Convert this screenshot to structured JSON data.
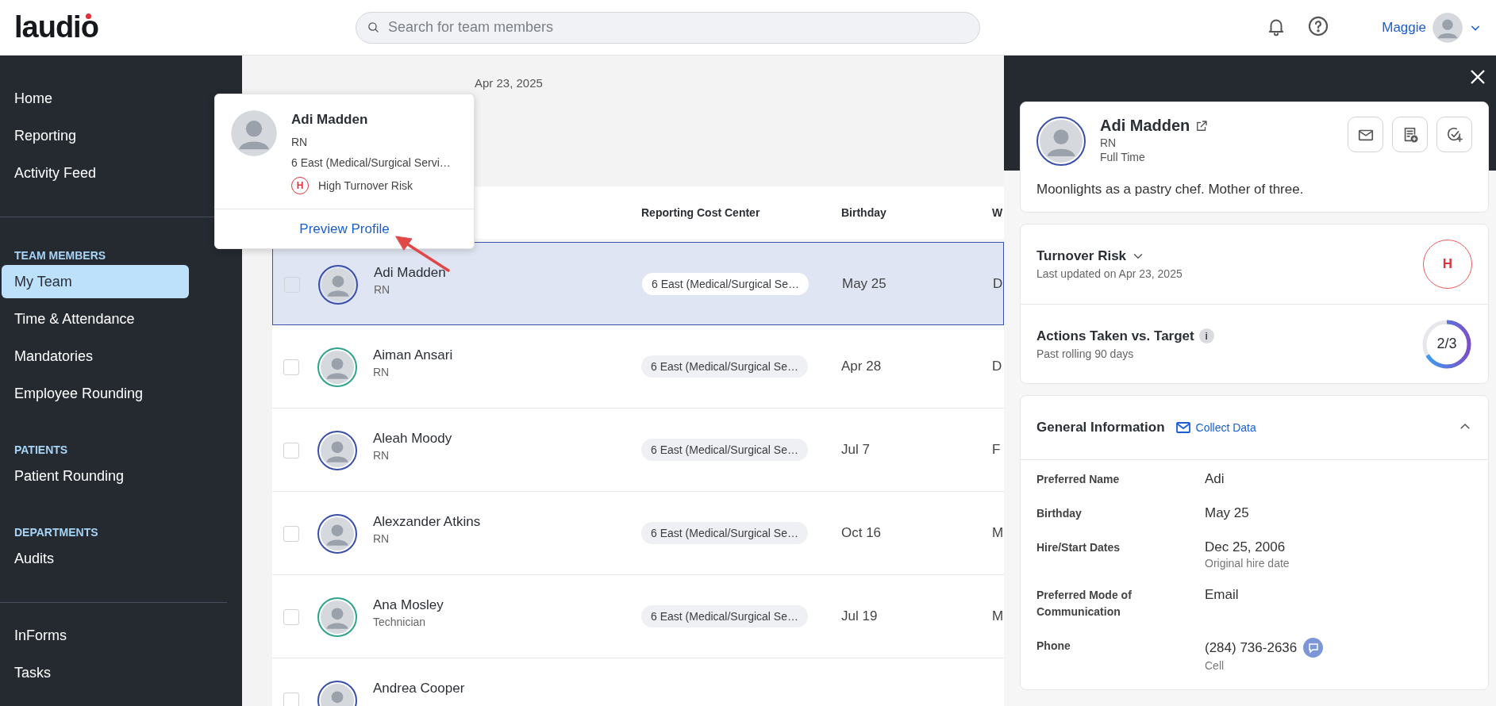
{
  "header": {
    "logo": "laudio",
    "search": {
      "placeholder": "Search for team members"
    },
    "user": {
      "name": "Maggie"
    }
  },
  "sidebar": {
    "groups": [
      {
        "items": [
          {
            "label": "Home",
            "selected": false
          },
          {
            "label": "Reporting",
            "selected": false
          },
          {
            "label": "Activity Feed",
            "selected": false
          }
        ]
      },
      {
        "heading": "TEAM MEMBERS",
        "items": [
          {
            "label": "My Team",
            "selected": true
          },
          {
            "label": "Time & Attendance",
            "selected": false
          },
          {
            "label": "Mandatories",
            "selected": false
          },
          {
            "label": "Employee Rounding",
            "selected": false
          }
        ]
      },
      {
        "heading": "PATIENTS",
        "items": [
          {
            "label": "Patient Rounding",
            "selected": false
          }
        ]
      },
      {
        "heading": "DEPARTMENTS",
        "items": [
          {
            "label": "Audits",
            "selected": false
          }
        ]
      },
      {
        "items": [
          {
            "label": "InForms",
            "selected": false
          },
          {
            "label": "Tasks",
            "selected": false
          }
        ]
      }
    ]
  },
  "page": {
    "date": "Apr 23, 2025"
  },
  "table": {
    "columns": [
      {
        "label": "Reporting Cost Center"
      },
      {
        "label": "Birthday"
      },
      {
        "label": "W"
      }
    ],
    "rows": [
      {
        "name": "Adi Madden",
        "role": "RN",
        "cost_center": "6 East (Medical/Surgical Se…",
        "birthday": "May 25",
        "column_3": "D",
        "selected": true,
        "checked": false,
        "color": "#3a4fa8"
      },
      {
        "name": "Aiman Ansari",
        "role": "RN",
        "cost_center": "6 East (Medical/Surgical Se…",
        "birthday": "Apr 28",
        "column_3": "D",
        "selected": false,
        "checked": false,
        "color": "#2fa38c"
      },
      {
        "name": "Aleah Moody",
        "role": "RN",
        "cost_center": "6 East (Medical/Surgical Se…",
        "birthday": "Jul 7",
        "column_3": "F",
        "selected": false,
        "checked": false,
        "color": "#3a4fa8"
      },
      {
        "name": "Alexzander Atkins",
        "role": "RN",
        "cost_center": "6 East (Medical/Surgical Se…",
        "birthday": "Oct 16",
        "column_3": "M",
        "selected": false,
        "checked": false,
        "color": "#3a4fa8"
      },
      {
        "name": "Ana Mosley",
        "role": "Technician",
        "cost_center": "6 East (Medical/Surgical Se…",
        "birthday": "Jul 19",
        "column_3": "M",
        "selected": false,
        "checked": false,
        "color": "#2fa38c"
      },
      {
        "name": "Andrea Cooper",
        "selected": false,
        "checked": false,
        "color": "#3a4fa8"
      }
    ]
  },
  "popup": {
    "name": "Adi Madden",
    "role": "RN",
    "unit": "6 East (Medical/Surgical Servi…",
    "risk": {
      "badge": "H",
      "label": "High Turnover Risk"
    },
    "link": "Preview Profile"
  },
  "panel": {
    "profile": {
      "name": "Adi Madden",
      "role": "RN",
      "employment": "Full Time",
      "note": "Moonlights as a pastry chef. Mother of three."
    },
    "turnover_risk": {
      "title": "Turnover Risk",
      "updated": "Last updated on Apr 23, 2025",
      "badge": "H"
    },
    "actions": {
      "title": "Actions Taken vs. Target",
      "info": "i",
      "subtitle": "Past rolling 90 days",
      "reading": "2/3",
      "level": 0.667
    },
    "general": {
      "title": "General Information",
      "link": "Collect Data",
      "expanded": true,
      "fields": [
        {
          "kind": "text",
          "label": "Preferred Name",
          "value": "Adi"
        },
        {
          "kind": "text",
          "label": "Birthday",
          "value": "May 25"
        },
        {
          "kind": "text",
          "label": "Hire/Start Dates",
          "value": "Dec 25, 2006",
          "note": "Original hire date"
        },
        {
          "kind": "text",
          "label": "Preferred Mode of Communication",
          "value": "Email"
        },
        {
          "kind": "phone",
          "label": "Phone",
          "value": "(284) 736-2636",
          "note": "Cell"
        }
      ]
    }
  }
}
